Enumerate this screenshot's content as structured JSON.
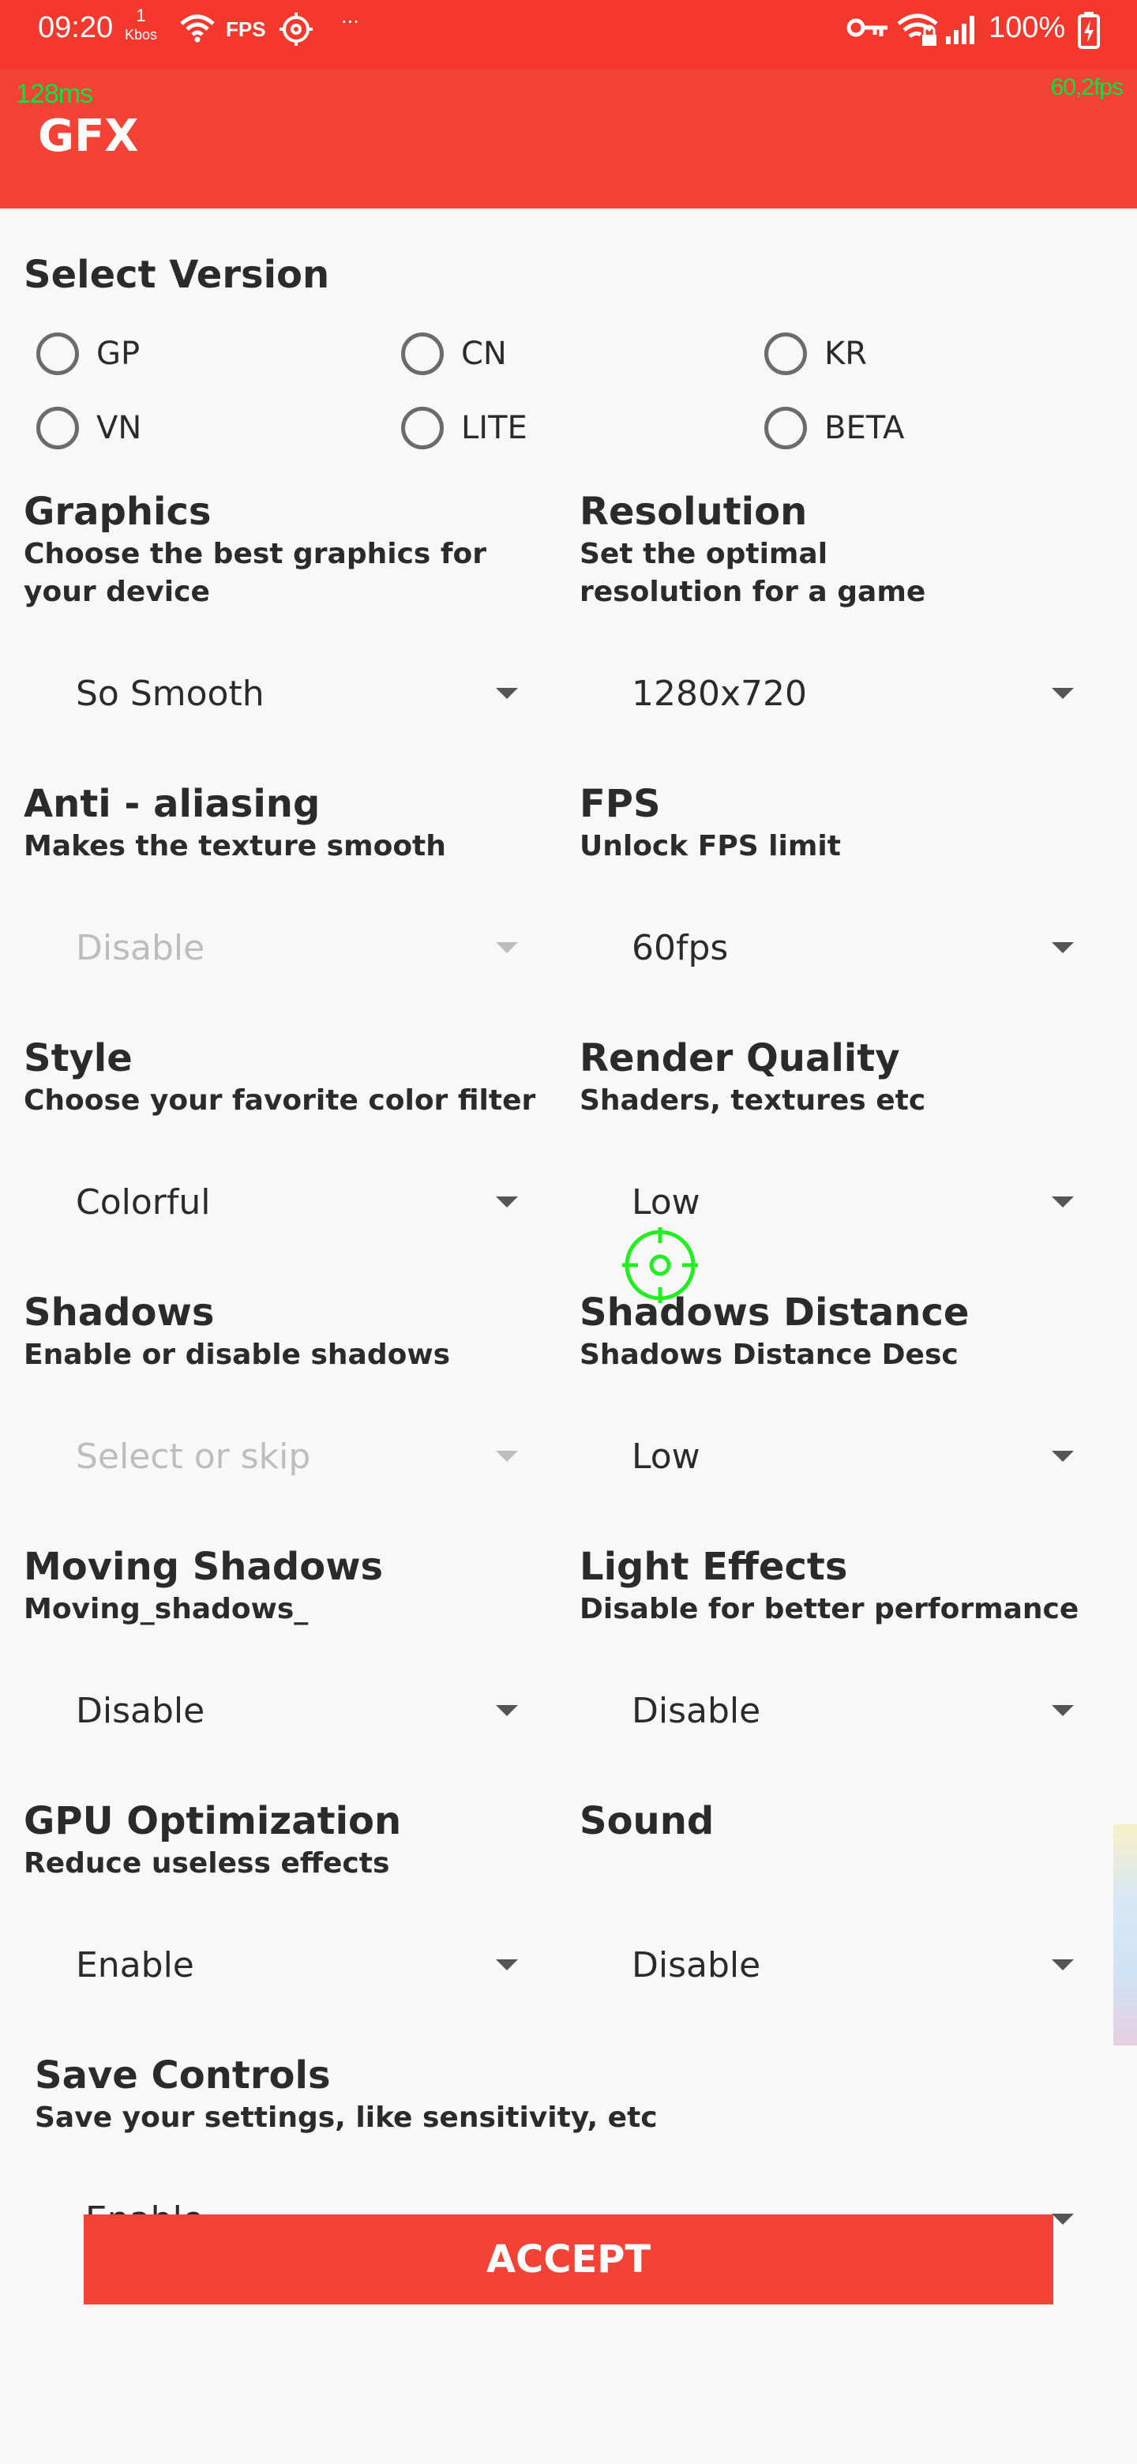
{
  "status_bar": {
    "time": "09:20",
    "kbps_value": "1",
    "kbps_unit": "Kbos",
    "fps_label": "FPS",
    "dots": "···",
    "battery": "100%"
  },
  "overlay": {
    "latency": "128ms",
    "fps": "60,2fps"
  },
  "app_bar": {
    "title": "GFX"
  },
  "version": {
    "title": "Select Version",
    "options": [
      "GP",
      "CN",
      "KR",
      "VN",
      "LITE",
      "BETA"
    ]
  },
  "settings": [
    {
      "title": "Graphics",
      "desc": "Choose the best graphics for your device",
      "value": "So Smooth",
      "enabled": true
    },
    {
      "title": "Resolution",
      "desc": "Set the optimal resolution for a game",
      "value": "1280x720",
      "enabled": true
    },
    {
      "title": "Anti - aliasing",
      "desc": "Makes the texture smooth",
      "value": "Disable",
      "enabled": false
    },
    {
      "title": "FPS",
      "desc": "Unlock FPS limit",
      "value": "60fps",
      "enabled": true
    },
    {
      "title": "Style",
      "desc": "Choose your favorite color filter",
      "value": "Colorful",
      "enabled": true
    },
    {
      "title": "Render Quality",
      "desc": "Shaders, textures etc",
      "value": "Low",
      "enabled": true
    },
    {
      "title": "Shadows",
      "desc": "Enable or disable shadows",
      "value": "Select or skip",
      "enabled": false
    },
    {
      "title": "Shadows Distance",
      "desc": "Shadows Distance Desc",
      "value": "Low",
      "enabled": true
    },
    {
      "title": "Moving Shadows",
      "desc": "Moving_shadows_",
      "value": "Disable",
      "enabled": true
    },
    {
      "title": "Light Effects",
      "desc": "Disable for better performance",
      "value": "Disable",
      "enabled": true
    },
    {
      "title": "GPU Optimization",
      "desc": "Reduce useless effects",
      "value": "Enable",
      "enabled": true
    },
    {
      "title": "Sound",
      "desc": "",
      "value": "Disable",
      "enabled": true
    }
  ],
  "save_controls": {
    "title": "Save Controls",
    "desc": "Save your settings, like sensitivity, etc",
    "value": "Enable"
  },
  "accept_label": "ACCEPT",
  "colors": {
    "status_bar": "#f5382e",
    "app_bar": "#f44336",
    "overlay_text": "#00e640",
    "accent": "#f44336"
  }
}
